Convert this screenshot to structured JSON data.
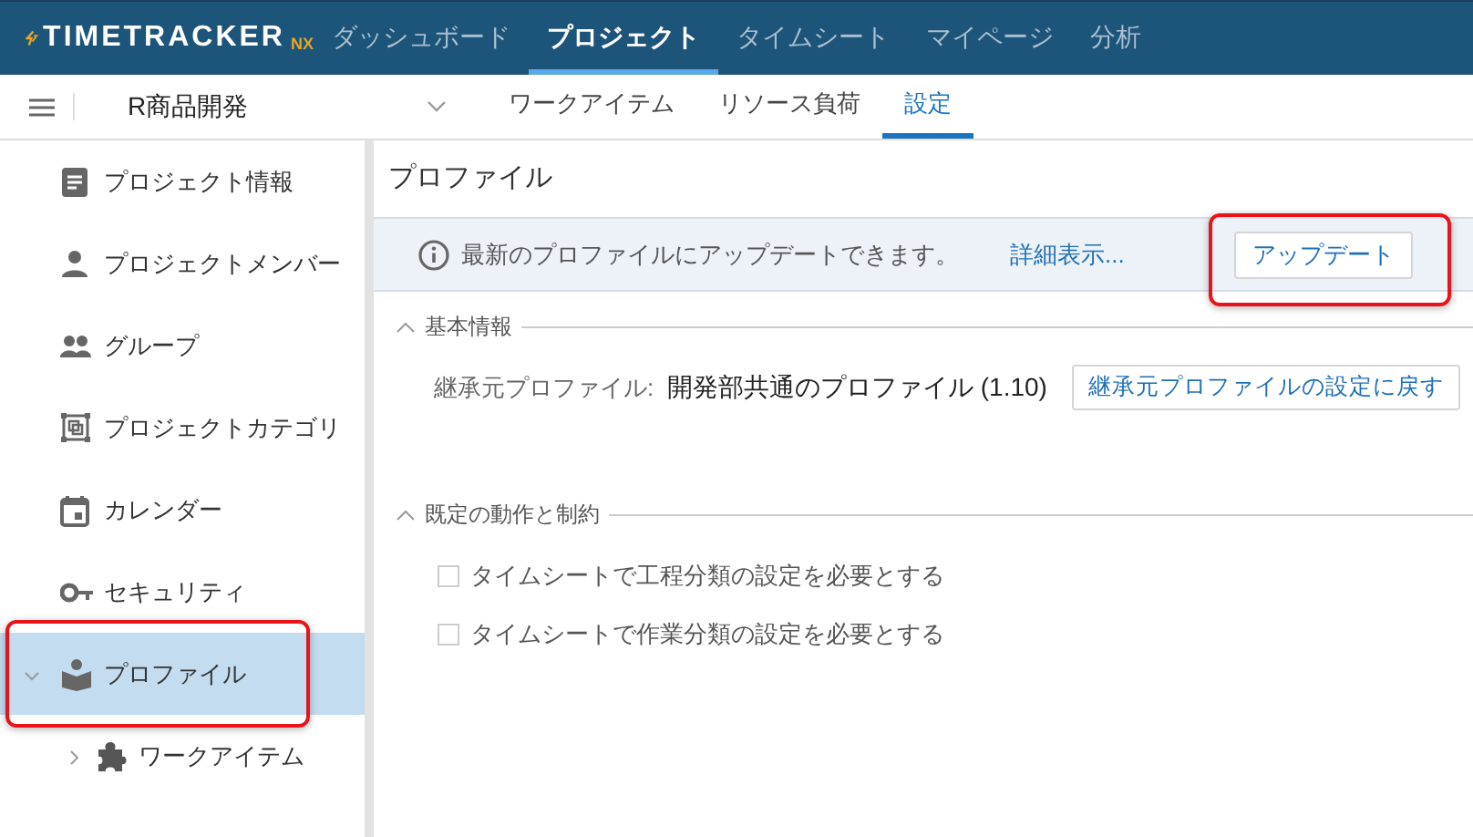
{
  "app": {
    "logo": "TIMETRACKER",
    "logo_suffix": "NX"
  },
  "nav": [
    {
      "label": "ダッシュボード",
      "selected": false
    },
    {
      "label": "プロジェクト",
      "selected": true
    },
    {
      "label": "タイムシート",
      "selected": false
    },
    {
      "label": "マイページ",
      "selected": false
    },
    {
      "label": "分析",
      "selected": false
    }
  ],
  "project_bar": {
    "project": "R商品開発",
    "tabs": [
      {
        "label": "ワークアイテム",
        "selected": false
      },
      {
        "label": "リソース負荷",
        "selected": false
      },
      {
        "label": "設定",
        "selected": true
      }
    ]
  },
  "sidebar": {
    "items": [
      {
        "label": "プロジェクト情報",
        "selected": false,
        "highlighted": false
      },
      {
        "label": "プロジェクトメンバー",
        "selected": false,
        "highlighted": false
      },
      {
        "label": "グループ",
        "selected": false,
        "highlighted": false
      },
      {
        "label": "プロジェクトカテゴリ",
        "selected": false,
        "highlighted": false
      },
      {
        "label": "カレンダー",
        "selected": false,
        "highlighted": false
      },
      {
        "label": "セキュリティ",
        "selected": false,
        "highlighted": false
      },
      {
        "label": "プロファイル",
        "selected": true,
        "highlighted": true,
        "expanded": true,
        "children": [
          {
            "label": "ワークアイテム",
            "selected": false,
            "expanded": false
          }
        ]
      }
    ]
  },
  "panel": {
    "title": "プロファイル",
    "notice": {
      "text": "最新のプロファイルにアップデートできます。",
      "link": "詳細表示...",
      "button": "アップデート",
      "highlighted": true
    },
    "sections": [
      {
        "title": "基本情報",
        "expanded": true,
        "fields": [
          {
            "label": "継承元プロファイル:",
            "value": "開発部共通のプロファイル (1.10)",
            "button": "継承元プロファイルの設定に戻す"
          }
        ]
      },
      {
        "title": "既定の動作と制約",
        "expanded": true,
        "checkboxes": [
          {
            "label": "タイムシートで工程分類の設定を必要とする",
            "checked": false
          },
          {
            "label": "タイムシートで作業分類の設定を必要とする",
            "checked": false
          }
        ]
      }
    ]
  }
}
